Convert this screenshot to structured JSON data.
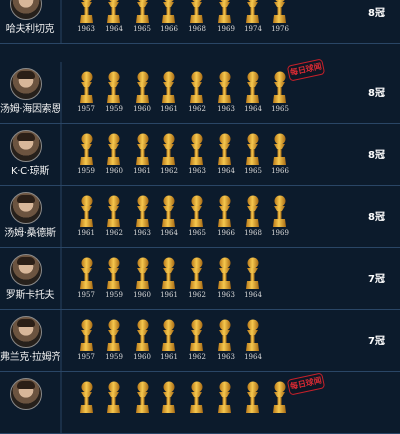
{
  "players": [
    {
      "name": "哈夫利切克",
      "years": [
        "1963",
        "1964",
        "1965",
        "1966",
        "1968",
        "1969",
        "1974",
        "1976"
      ],
      "count": "8冠"
    },
    {
      "name": "汤姆·海因索恩",
      "years": [
        "1957",
        "1959",
        "1960",
        "1961",
        "1962",
        "1963",
        "1964",
        "1965"
      ],
      "count": "8冠"
    },
    {
      "name": "K·C·琼斯",
      "years": [
        "1959",
        "1960",
        "1961",
        "1962",
        "1963",
        "1964",
        "1965",
        "1966"
      ],
      "count": "8冠"
    },
    {
      "name": "汤姆·桑德斯",
      "years": [
        "1961",
        "1962",
        "1963",
        "1964",
        "1965",
        "1966",
        "1968",
        "1969"
      ],
      "count": "8冠"
    },
    {
      "name": "罗斯卡托夫",
      "years": [
        "1957",
        "1959",
        "1960",
        "1961",
        "1962",
        "1963",
        "1964"
      ],
      "count": "7冠"
    },
    {
      "name": "弗兰克·拉姆齐",
      "years": [
        "1957",
        "1959",
        "1960",
        "1961",
        "1962",
        "1963",
        "1964"
      ],
      "count": "7冠"
    },
    {
      "name": "",
      "years": [
        "",
        "",
        "",
        "",
        "",
        "",
        "",
        ""
      ],
      "count": ""
    }
  ],
  "stamps": [
    {
      "text": "每日球闻"
    },
    {
      "text": "每日球闻"
    }
  ],
  "colors": {
    "background": "#0c1b2c",
    "trophy": "#e2a52a",
    "divider": "#2a4666"
  },
  "icons": {
    "trophy": "trophy-icon",
    "avatar": "player-avatar"
  }
}
